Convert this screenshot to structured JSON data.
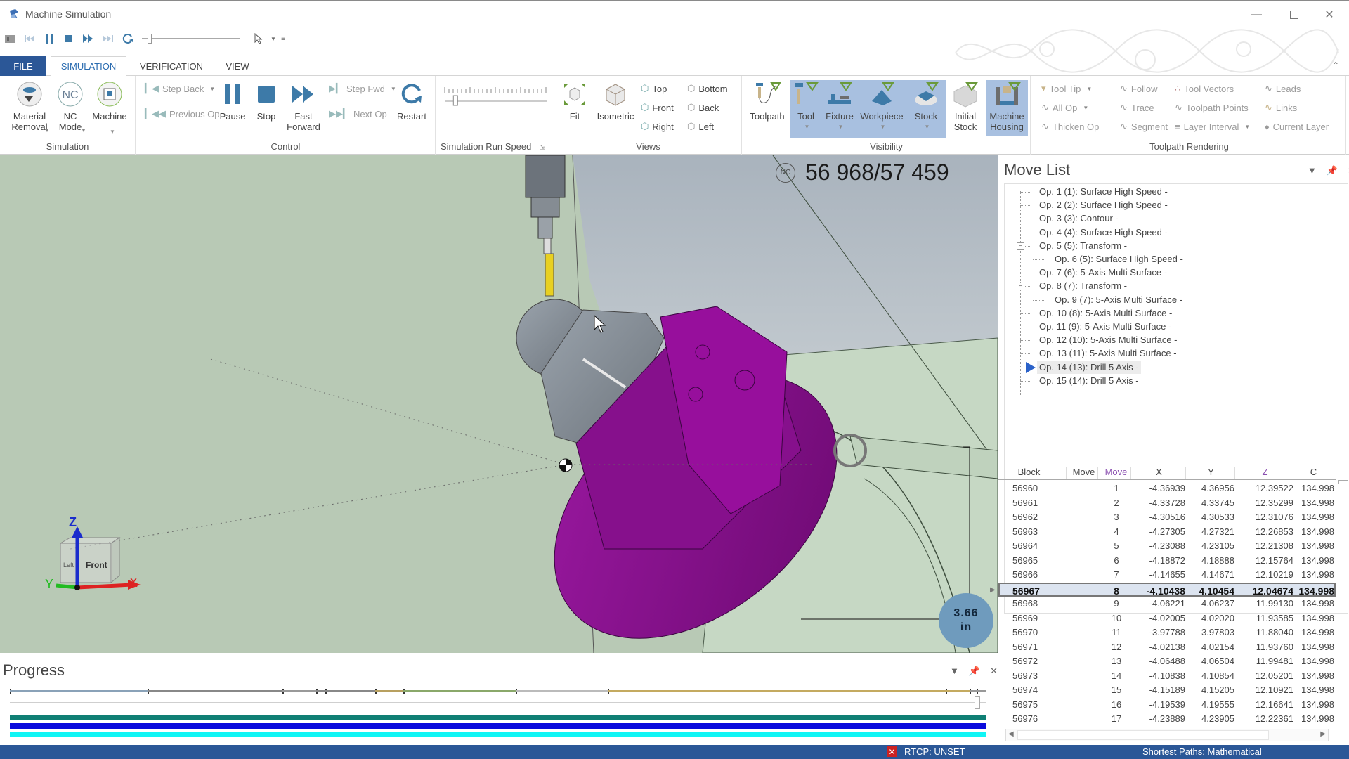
{
  "window": {
    "title": "Machine Simulation",
    "minimize_icon": "minimize-icon",
    "maximize_icon": "maximize-icon",
    "close_icon": "close-icon"
  },
  "quick_access": {
    "icons": [
      "simulation-icon",
      "skip-back-icon",
      "pause-icon",
      "stop-icon",
      "fast-forward-icon",
      "skip-forward-icon",
      "restart-icon",
      "speed-slider",
      "pointer-icon",
      "dropdown-icon",
      "customize-icon"
    ]
  },
  "ribbon_tabs": [
    {
      "label": "FILE"
    },
    {
      "label": "SIMULATION",
      "active": true
    },
    {
      "label": "VERIFICATION"
    },
    {
      "label": "VIEW"
    }
  ],
  "ribbon": {
    "simulation": {
      "label": "Simulation",
      "material_removal": "Material\nRemoval",
      "nc_mode": "NC\nMode",
      "machine": "Machine"
    },
    "control": {
      "label": "Control",
      "step_back": "Step Back",
      "previous_op": "Previous Op",
      "pause": "Pause",
      "stop": "Stop",
      "fast_forward": "Fast\nForward",
      "step_fwd": "Step Fwd",
      "next_op": "Next Op",
      "restart": "Restart"
    },
    "run_speed": {
      "label": "Simulation Run Speed",
      "speed_fraction": 0.05
    },
    "views": {
      "label": "Views",
      "fit": "Fit",
      "isometric": "Isometric",
      "top": "Top",
      "front": "Front",
      "right": "Right",
      "bottom": "Bottom",
      "back": "Back",
      "left": "Left"
    },
    "visibility": {
      "label": "Visibility",
      "toolpath": "Toolpath",
      "tool": "Tool",
      "fixture": "Fixture",
      "workpiece": "Workpiece",
      "stock": "Stock",
      "initial_stock": "Initial\nStock",
      "machine_housing": "Machine\nHousing"
    },
    "toolpath_rendering": {
      "label": "Toolpath Rendering",
      "tool_tip": "Tool Tip",
      "all_op": "All Op",
      "thicken_op": "Thicken Op",
      "follow": "Follow",
      "trace": "Trace",
      "segment": "Segment",
      "tool_vectors": "Tool Vectors",
      "toolpath_points": "Toolpath Points",
      "layer_interval": "Layer Interval",
      "leads": "Leads",
      "links": "Links",
      "current_layer": "Current Layer"
    }
  },
  "viewport": {
    "nc_badge": "NC",
    "nc_counter": "56 968/57 459",
    "measurement_value": "3.66",
    "measurement_unit": "in",
    "view_cube_face": "Front",
    "view_cube_side": "Left",
    "axis_labels": {
      "x": "X",
      "y": "Y",
      "z": "Z"
    },
    "colors": {
      "workpiece": "#8a0d8f",
      "machine": "#c5d8c3",
      "background": "#b8c7b6"
    }
  },
  "progress": {
    "title": "Progress",
    "current_fraction": 0.991,
    "operation_boundaries": [
      0.0,
      0.141,
      0.279,
      0.314,
      0.323,
      0.374,
      0.403,
      0.518,
      0.612,
      0.958,
      0.983,
      0.99
    ],
    "bars": [
      {
        "name": "progress-bar-teal",
        "color": "#0f7f74",
        "fraction": 1.0
      },
      {
        "name": "progress-bar-blue",
        "color": "#0b0bdc",
        "fraction": 1.0
      },
      {
        "name": "progress-bar-cyan",
        "color": "#10f5f5",
        "fraction": 1.0
      }
    ]
  },
  "move_list": {
    "title": "Move List",
    "operations": [
      {
        "label": "Op. 1 (1): Surface High Speed -",
        "level": 0
      },
      {
        "label": "Op. 2 (2): Surface High Speed -",
        "level": 0
      },
      {
        "label": "Op. 3 (3): Contour -",
        "level": 0
      },
      {
        "label": "Op. 4 (4): Surface High Speed -",
        "level": 0
      },
      {
        "label": "Op. 5 (5): Transform -",
        "level": 0,
        "expanded": true
      },
      {
        "label": "Op. 6 (5): Surface High Speed -",
        "level": 1
      },
      {
        "label": "Op. 7 (6): 5-Axis Multi Surface -",
        "level": 0
      },
      {
        "label": "Op. 8 (7): Transform -",
        "level": 0,
        "expanded": true
      },
      {
        "label": "Op. 9 (7): 5-Axis Multi Surface -",
        "level": 1
      },
      {
        "label": "Op. 10 (8): 5-Axis Multi Surface -",
        "level": 0
      },
      {
        "label": "Op. 11 (9): 5-Axis Multi Surface -",
        "level": 0
      },
      {
        "label": "Op. 12 (10): 5-Axis Multi Surface -",
        "level": 0
      },
      {
        "label": "Op. 13 (11): 5-Axis Multi Surface -",
        "level": 0
      },
      {
        "label": "Op. 14 (13): Drill 5 Axis -",
        "level": 0,
        "current": true
      },
      {
        "label": "Op. 15 (14): Drill 5 Axis -",
        "level": 0
      }
    ],
    "columns": [
      "Block",
      "Move",
      "Move",
      "X",
      "Y",
      "Z",
      "C"
    ],
    "rows": [
      [
        "56960",
        "",
        "1",
        "-4.36939",
        "4.36956",
        "12.39522",
        "134.998"
      ],
      [
        "56961",
        "",
        "2",
        "-4.33728",
        "4.33745",
        "12.35299",
        "134.998"
      ],
      [
        "56962",
        "",
        "3",
        "-4.30516",
        "4.30533",
        "12.31076",
        "134.998"
      ],
      [
        "56963",
        "",
        "4",
        "-4.27305",
        "4.27321",
        "12.26853",
        "134.998"
      ],
      [
        "56964",
        "",
        "5",
        "-4.23088",
        "4.23105",
        "12.21308",
        "134.998"
      ],
      [
        "56965",
        "",
        "6",
        "-4.18872",
        "4.18888",
        "12.15764",
        "134.998"
      ],
      [
        "56966",
        "",
        "7",
        "-4.14655",
        "4.14671",
        "12.10219",
        "134.998"
      ],
      [
        "56967",
        "",
        "8",
        "-4.10438",
        "4.10454",
        "12.04674",
        "134.998"
      ],
      [
        "56968",
        "",
        "9",
        "-4.06221",
        "4.06237",
        "11.99130",
        "134.998"
      ],
      [
        "56969",
        "",
        "10",
        "-4.02005",
        "4.02020",
        "11.93585",
        "134.998"
      ],
      [
        "56970",
        "",
        "11",
        "-3.97788",
        "3.97803",
        "11.88040",
        "134.998"
      ],
      [
        "56971",
        "",
        "12",
        "-4.02138",
        "4.02154",
        "11.93760",
        "134.998"
      ],
      [
        "56972",
        "",
        "13",
        "-4.06488",
        "4.06504",
        "11.99481",
        "134.998"
      ],
      [
        "56973",
        "",
        "14",
        "-4.10838",
        "4.10854",
        "12.05201",
        "134.998"
      ],
      [
        "56974",
        "",
        "15",
        "-4.15189",
        "4.15205",
        "12.10921",
        "134.998"
      ],
      [
        "56975",
        "",
        "16",
        "-4.19539",
        "4.19555",
        "12.16641",
        "134.998"
      ],
      [
        "56976",
        "",
        "17",
        "-4.23889",
        "4.23905",
        "12.22361",
        "134.998"
      ]
    ],
    "selected_row_index": 7
  },
  "status_bar": {
    "rtcp_icon": "error-x-icon",
    "rtcp": "RTCP: UNSET",
    "shortest_paths": "Shortest Paths: Mathematical"
  }
}
